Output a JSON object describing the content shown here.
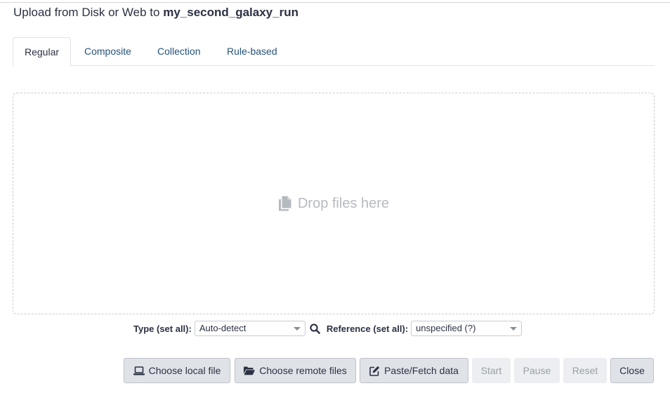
{
  "header": {
    "prefix": "Upload from Disk or Web to ",
    "history_name": "my_second_galaxy_run"
  },
  "tabs": [
    {
      "label": "Regular",
      "active": true
    },
    {
      "label": "Composite",
      "active": false
    },
    {
      "label": "Collection",
      "active": false
    },
    {
      "label": "Rule-based",
      "active": false
    }
  ],
  "dropzone": {
    "icon": "copy-files-icon",
    "label": "Drop files here"
  },
  "settings": {
    "type_label": "Type (set all):",
    "type_value": "Auto-detect",
    "search_icon": "search-icon",
    "reference_label": "Reference (set all):",
    "reference_value": "unspecified (?)"
  },
  "buttons": {
    "choose_local": {
      "label": "Choose local file",
      "icon": "laptop-icon"
    },
    "choose_remote": {
      "label": "Choose remote files",
      "icon": "folder-open-icon"
    },
    "paste_fetch": {
      "label": "Paste/Fetch data",
      "icon": "edit-icon"
    },
    "start": {
      "label": "Start",
      "disabled": true
    },
    "pause": {
      "label": "Pause",
      "disabled": true
    },
    "reset": {
      "label": "Reset",
      "disabled": true
    },
    "close": {
      "label": "Close",
      "disabled": false
    }
  },
  "colors": {
    "tab_link": "#25537b",
    "button_bg": "#dfe3e8",
    "disabled_text": "#9aa0a8",
    "drop_text": "#b6bac0"
  }
}
